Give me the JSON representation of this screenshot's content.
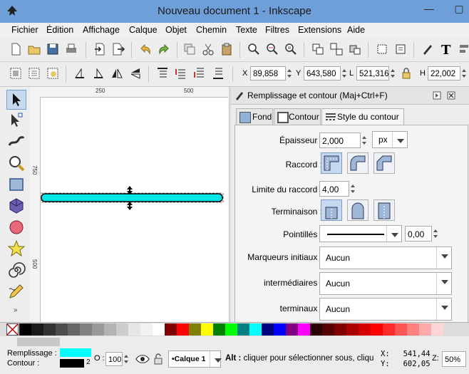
{
  "window": {
    "title": "Nouveau document 1 - Inkscape"
  },
  "menu": [
    "Fichier",
    "Édition",
    "Affichage",
    "Calque",
    "Objet",
    "Chemin",
    "Texte",
    "Filtres",
    "Extensions",
    "Aide"
  ],
  "controls": {
    "x_label": "X",
    "x_value": "89,858",
    "y_label": "Y",
    "y_value": "643,580",
    "l_label": "L",
    "l_value": "521,316",
    "h_label": "H",
    "h_value": "22,002"
  },
  "rulers": {
    "h_ticks": [
      "250",
      "500"
    ],
    "v_ticks": [
      "750",
      "500"
    ]
  },
  "panel": {
    "title": "Remplissage et contour (Maj+Ctrl+F)",
    "tabs": [
      "Fond",
      "Contour",
      "Style du contour"
    ],
    "width_label": "Épaisseur :",
    "width_value": "2,000",
    "unit_value": "px",
    "join_label": "Raccord :",
    "miter_label": "Limite du raccord :",
    "miter_value": "4,00",
    "cap_label": "Terminaison :",
    "dash_label": "Pointillés :",
    "dash_offset": "0,00",
    "start_marker_label": "Marqueurs initiaux :",
    "start_marker_value": "Aucun",
    "mid_marker_label": "intermédiaires :",
    "mid_marker_value": "Aucun",
    "end_marker_label": "terminaux :",
    "end_marker_value": "Aucun"
  },
  "palette": [
    "#000000",
    "#1a1a1a",
    "#333333",
    "#4d4d4d",
    "#666666",
    "#808080",
    "#999999",
    "#b3b3b3",
    "#cccccc",
    "#e6e6e6",
    "#f2f2f2",
    "#ffffff",
    "#800000",
    "#ff0000",
    "#808000",
    "#ffff00",
    "#008000",
    "#00ff00",
    "#008080",
    "#00ffff",
    "#000080",
    "#0000ff",
    "#800080",
    "#ff00ff",
    "#2b0000",
    "#550000",
    "#800000",
    "#aa0000",
    "#d40000",
    "#ff0000",
    "#ff2a2a",
    "#ff5555",
    "#ff8080",
    "#ffaaaa",
    "#ffd5d5"
  ],
  "status": {
    "fill_label": "Remplissage :",
    "stroke_label": "Contour :",
    "fill_color": "#00ffff",
    "stroke_color": "#000000",
    "stroke_width": "2",
    "opacity_label": "O :",
    "opacity_value": "100",
    "layer_value": "•Calque 1",
    "message_key": "Alt :",
    "message": " cliquer pour sélectionner sous, cliqu",
    "cursor_x": "X:   541,44",
    "cursor_y": "Y:   602,05",
    "zoom_label": "Z:",
    "zoom_value": "50%"
  }
}
